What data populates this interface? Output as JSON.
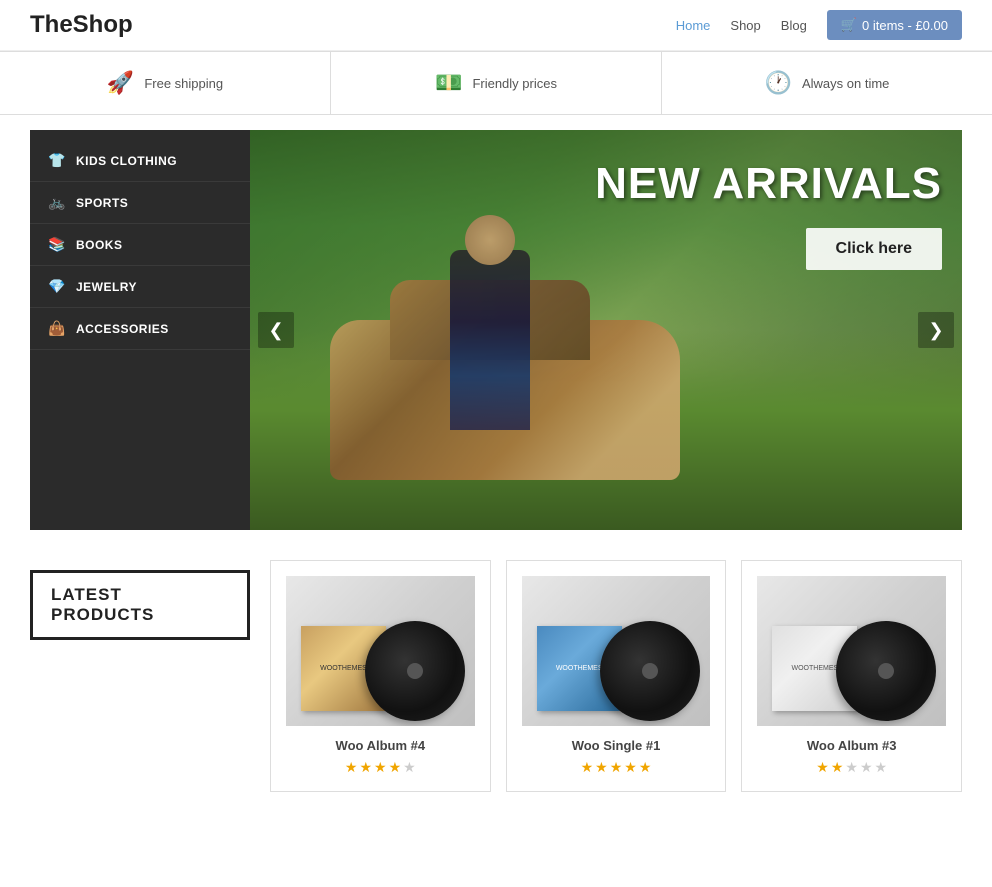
{
  "header": {
    "logo": "TheShop",
    "nav": [
      {
        "label": "Home",
        "active": true
      },
      {
        "label": "Shop",
        "active": false
      },
      {
        "label": "Blog",
        "active": false
      }
    ],
    "cart_label": "0 items - £0.00",
    "cart_icon": "🛒"
  },
  "features": [
    {
      "icon": "🚀",
      "text": "Free shipping"
    },
    {
      "icon": "💵",
      "text": "Friendly prices"
    },
    {
      "icon": "🕐",
      "text": "Always on time"
    }
  ],
  "sidebar": {
    "items": [
      {
        "icon": "👕",
        "label": "Kids Clothing"
      },
      {
        "icon": "🚲",
        "label": "Sports"
      },
      {
        "icon": "📚",
        "label": "Books"
      },
      {
        "icon": "💎",
        "label": "Jewelry"
      },
      {
        "icon": "👜",
        "label": "Accessories"
      }
    ]
  },
  "hero": {
    "title": "NEW ARRIVALS",
    "button_label": "Click here",
    "prev_label": "❮",
    "next_label": "❯"
  },
  "products_section": {
    "heading": "LATEST PRODUCTS",
    "products": [
      {
        "name": "Woo Album #4",
        "stars": 4,
        "max_stars": 5,
        "cover_type": "gold"
      },
      {
        "name": "Woo Single #1",
        "stars": 5,
        "max_stars": 5,
        "cover_type": "blue"
      },
      {
        "name": "Woo Album #3",
        "stars": 2,
        "max_stars": 5,
        "cover_type": "grey"
      }
    ]
  }
}
